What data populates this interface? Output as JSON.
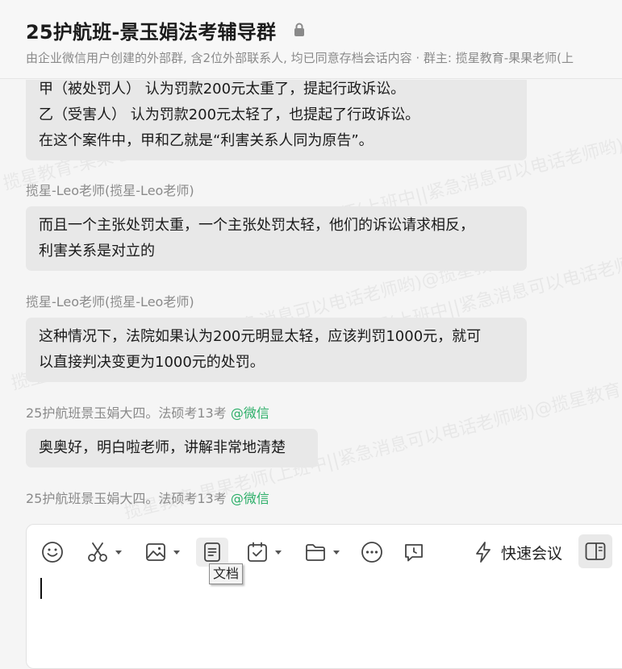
{
  "header": {
    "title": "25护航班-景玉娟法考辅导群",
    "subtitle": "由企业微信用户创建的外部群, 含2位外部联系人, 均已同意存档会话内容 · 群主: 揽星教育-果果老师(上"
  },
  "watermarks": [
    "揽星教育-果果老师(上班中||紧急消息可以电话老师哟)@揽星教育",
    "揽星教育-果果老师(上班中||紧急消息可以电话老师哟)@揽星教育",
    "揽星教育-果果老师(上班中||紧急消息可以电话老师哟)@揽星教育",
    "揽星教育-果果老师(上班中||紧急消息可以电话老师哟)@揽星教育",
    "揽星教育-果果老师(上班中||紧急消息可以电话老师哟)@揽星教育"
  ],
  "messages": [
    {
      "sender": "",
      "lines": [
        "甲（被处罚人） 认为罚款200元太重了，提起行政诉讼。",
        "乙（受害人） 认为罚款200元太轻了，也提起了行政诉讼。",
        "在这个案件中，甲和乙就是“利害关系人同为原告”。"
      ]
    },
    {
      "sender": "揽星-Leo老师(揽星-Leo老师)",
      "lines": [
        "而且一个主张处罚太重，一个主张处罚太轻，他们的诉讼请求相反，",
        "利害关系是对立的"
      ]
    },
    {
      "sender": "揽星-Leo老师(揽星-Leo老师)",
      "lines": [
        "这种情况下，法院如果认为200元明显太轻，应该判罚1000元，就可",
        "以直接判决变更为1000元的处罚。"
      ]
    },
    {
      "sender": "25护航班景玉娟大四。法硕考13考",
      "sender_suffix": "@微信",
      "lines": [
        "奥奥好，明白啦老师，讲解非常地清楚"
      ]
    },
    {
      "sender": "25护航班景玉娟大四。法硕考13考",
      "sender_suffix": "@微信",
      "lines": []
    }
  ],
  "composer": {
    "quick_meeting_label": "快速会议",
    "tooltip": "文档",
    "input_value": ""
  },
  "icons": {
    "emoji": "smile-icon",
    "screenshot": "scissors-icon",
    "image": "image-icon",
    "document": "document-icon",
    "schedule": "calendar-check-icon",
    "folder": "folder-icon",
    "more": "more-icon",
    "chat_record": "chat-bubble-icon",
    "meeting": "lightning-icon",
    "panel": "side-panel-icon"
  },
  "colors": {
    "accent_green": "#2aae67",
    "bubble": "#e8e8e8"
  }
}
